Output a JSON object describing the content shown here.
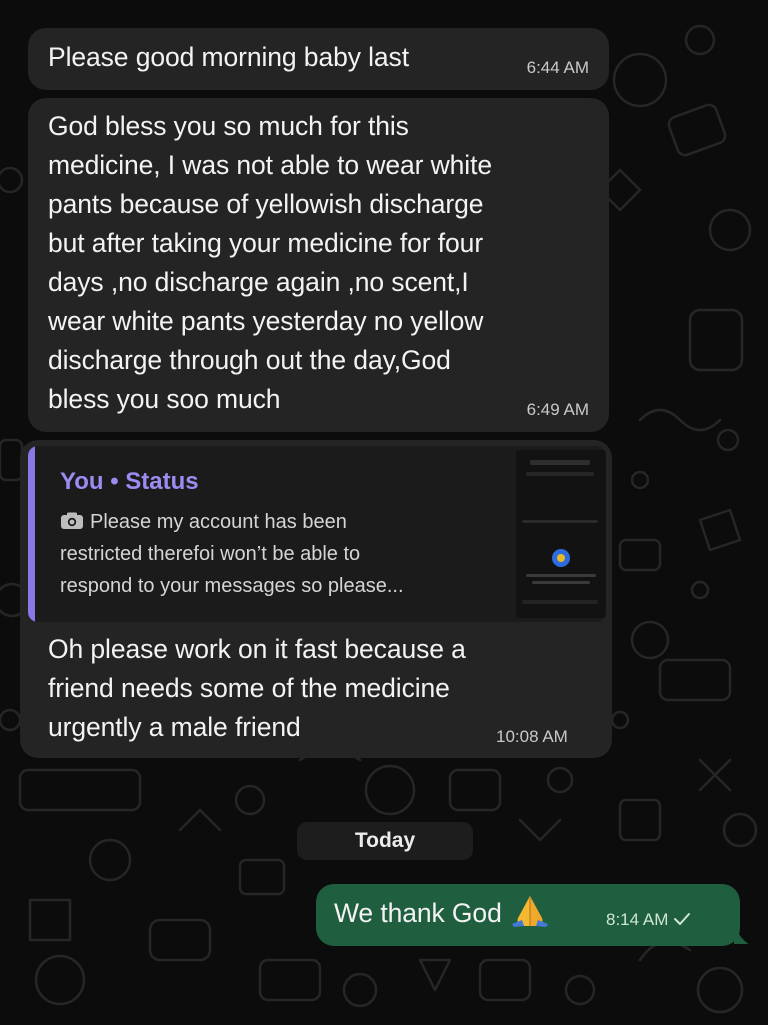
{
  "messages": [
    {
      "direction": "incoming",
      "text": "Please good morning baby last",
      "time": "6:44 AM"
    },
    {
      "direction": "incoming",
      "text": "God bless you so much for this\nmedicine, I was not able to wear white\npants because of yellowish discharge\nbut after taking your medicine for four\ndays ,no discharge again ,no scent,I\nwear white pants yesterday no yellow\ndischarge through out the day,God\nbless you soo much",
      "time": "6:49 AM"
    },
    {
      "direction": "incoming",
      "quote": {
        "title": "You • Status",
        "icon": "camera-icon",
        "text": "Please my account has been\nrestricted therefoi won’t be able to\nrespond to your messages so please..."
      },
      "text": "Oh please work on it fast because a\nfriend needs some of the medicine\nurgently a male friend",
      "time": "10:08 AM"
    },
    {
      "direction": "outgoing",
      "text": "We thank God",
      "emoji": "folded-hands-icon",
      "time": "8:14 AM",
      "status_icon": "single-check-icon"
    }
  ],
  "date_separator": "Today",
  "colors": {
    "background": "#0c0c0c",
    "incoming_bubble": "#242424",
    "outgoing_bubble": "#1f5e3f",
    "quote_accent": "#8b77e6"
  }
}
